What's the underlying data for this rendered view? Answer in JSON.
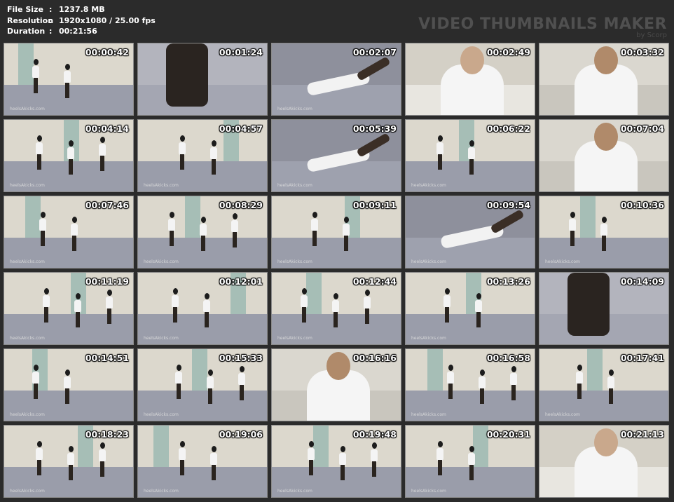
{
  "meta": [
    {
      "label": "File Size",
      "value": "1237.8 MB"
    },
    {
      "label": "Resolution",
      "value": "1920x1080 / 25.00 fps"
    },
    {
      "label": "Duration",
      "value": "00:21:56"
    }
  ],
  "brand": {
    "title": "VIDEO THUMBNAILS MAKER",
    "sub": "by Scorp"
  },
  "watermark": "heelsAkicks.com",
  "thumbnails": [
    {
      "time": "00:00:42",
      "kind": "room"
    },
    {
      "time": "00:01:24",
      "kind": "closeup-floor"
    },
    {
      "time": "00:02:07",
      "kind": "floor"
    },
    {
      "time": "00:02:49",
      "kind": "closeup-face"
    },
    {
      "time": "00:03:32",
      "kind": "closeup-person"
    },
    {
      "time": "00:04:14",
      "kind": "room"
    },
    {
      "time": "00:04:57",
      "kind": "room"
    },
    {
      "time": "00:05:39",
      "kind": "floor"
    },
    {
      "time": "00:06:22",
      "kind": "room"
    },
    {
      "time": "00:07:04",
      "kind": "closeup-person"
    },
    {
      "time": "00:07:46",
      "kind": "room"
    },
    {
      "time": "00:08:29",
      "kind": "room"
    },
    {
      "time": "00:09:11",
      "kind": "room"
    },
    {
      "time": "00:09:54",
      "kind": "floor"
    },
    {
      "time": "00:10:36",
      "kind": "room"
    },
    {
      "time": "00:11:19",
      "kind": "room"
    },
    {
      "time": "00:12:01",
      "kind": "room"
    },
    {
      "time": "00:12:44",
      "kind": "room"
    },
    {
      "time": "00:13:26",
      "kind": "room"
    },
    {
      "time": "00:14:09",
      "kind": "closeup-floor"
    },
    {
      "time": "00:14:51",
      "kind": "room"
    },
    {
      "time": "00:15:33",
      "kind": "room"
    },
    {
      "time": "00:16:16",
      "kind": "closeup-person"
    },
    {
      "time": "00:16:58",
      "kind": "room"
    },
    {
      "time": "00:17:41",
      "kind": "room"
    },
    {
      "time": "00:18:23",
      "kind": "room"
    },
    {
      "time": "00:19:06",
      "kind": "room"
    },
    {
      "time": "00:19:48",
      "kind": "room"
    },
    {
      "time": "00:20:31",
      "kind": "room"
    },
    {
      "time": "00:21:13",
      "kind": "closeup-face"
    }
  ]
}
